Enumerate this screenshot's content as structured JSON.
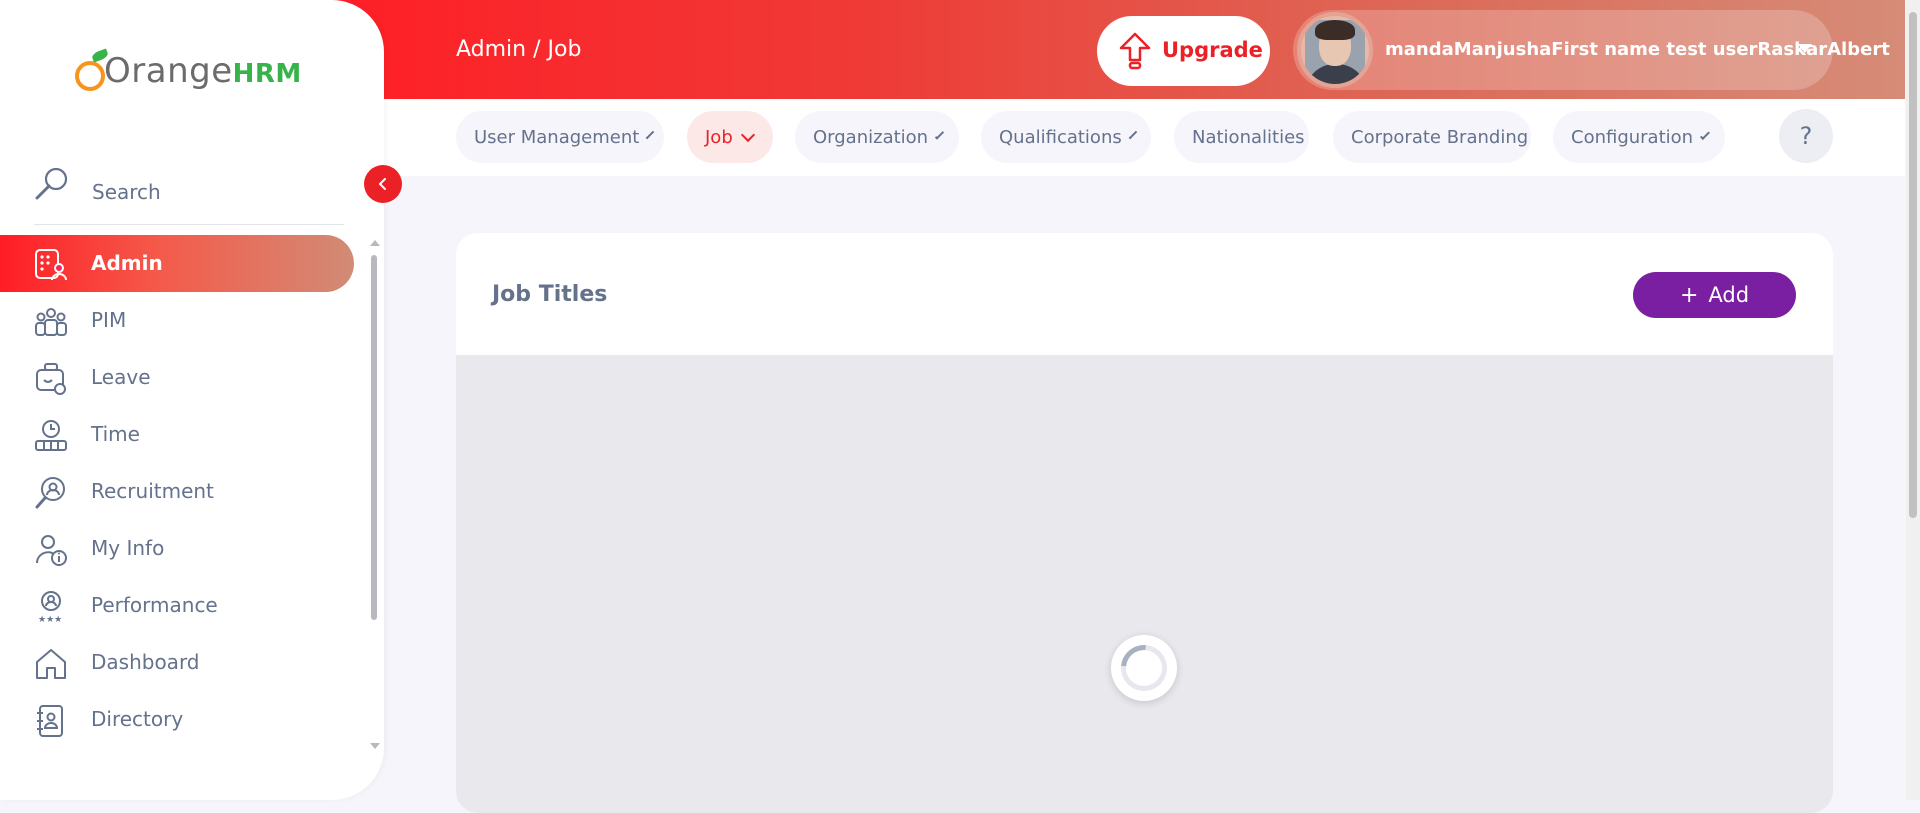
{
  "sidebar": {
    "logo": {
      "text": "Orange",
      "accent": "HRM"
    },
    "search_label": "Search",
    "items": [
      {
        "label": "Admin",
        "icon": "admin-icon",
        "active": true
      },
      {
        "label": "PIM",
        "icon": "pim-icon"
      },
      {
        "label": "Leave",
        "icon": "leave-icon"
      },
      {
        "label": "Time",
        "icon": "time-icon"
      },
      {
        "label": "Recruitment",
        "icon": "recruitment-icon"
      },
      {
        "label": "My Info",
        "icon": "my-info-icon"
      },
      {
        "label": "Performance",
        "icon": "performance-icon"
      },
      {
        "label": "Dashboard",
        "icon": "dashboard-icon"
      },
      {
        "label": "Directory",
        "icon": "directory-icon"
      }
    ]
  },
  "header": {
    "breadcrumb": "Admin / Job",
    "upgrade_label": "Upgrade",
    "user_name": "mandaManjushaFirst name test userRaskarAlbert"
  },
  "subnav": {
    "tabs": [
      {
        "label": "User Management",
        "dropdown": true
      },
      {
        "label": "Job",
        "dropdown": true,
        "active": true
      },
      {
        "label": "Organization",
        "dropdown": true
      },
      {
        "label": "Qualifications",
        "dropdown": true
      },
      {
        "label": "Nationalities",
        "dropdown": false
      },
      {
        "label": "Corporate Branding",
        "dropdown": false
      },
      {
        "label": "Configuration",
        "dropdown": true
      }
    ],
    "help_label": "?"
  },
  "main": {
    "title": "Job Titles",
    "add_label": "Add",
    "add_plus": "+"
  },
  "colors": {
    "accent": "#eb2128",
    "add_button": "#7b1fa2",
    "text_muted": "#64728c"
  }
}
